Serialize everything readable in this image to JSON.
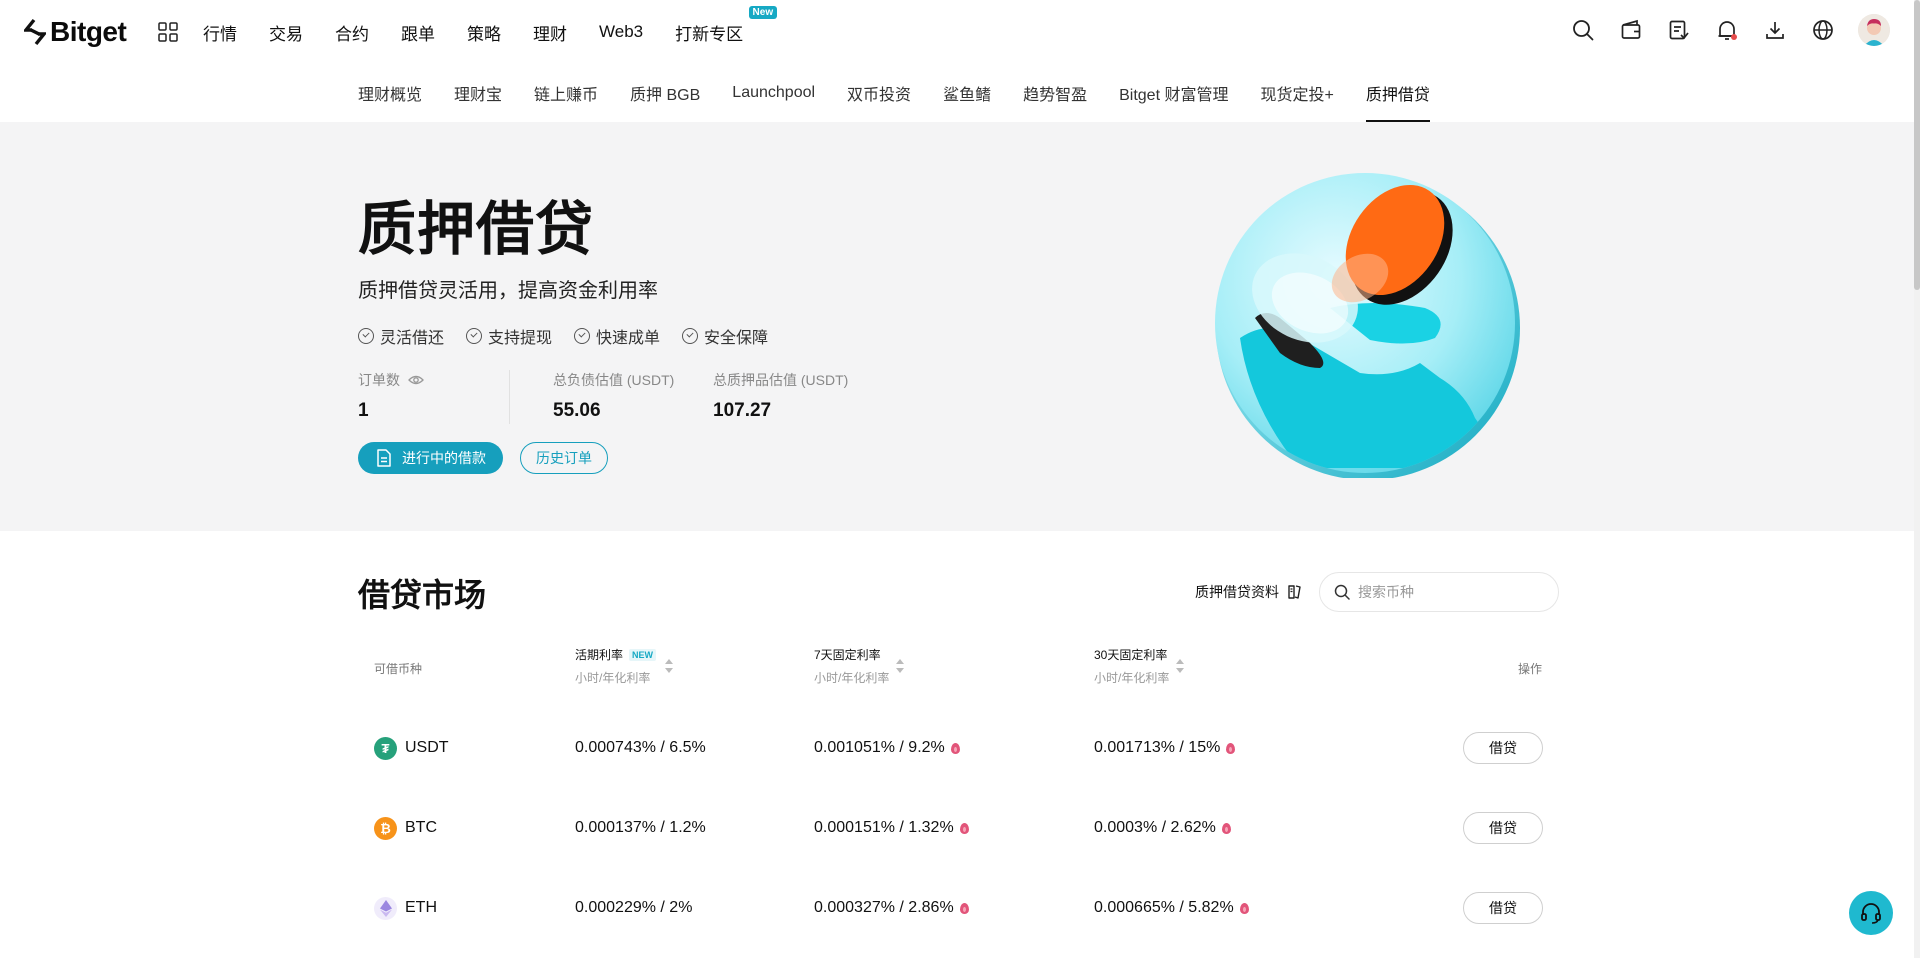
{
  "brand": {
    "name": "Bitget"
  },
  "topmenu": [
    "行情",
    "交易",
    "合约",
    "跟单",
    "策略",
    "理财",
    "Web3",
    "打新专区"
  ],
  "new_badge": "New",
  "subtabs": [
    "理财概览",
    "理财宝",
    "链上赚币",
    "质押 BGB",
    "Launchpool",
    "双币投资",
    "鲨鱼鳍",
    "趋势智盈",
    "Bitget 财富管理",
    "现货定投+",
    "质押借贷"
  ],
  "hero": {
    "title": "质押借贷",
    "subtitle": "质押借贷灵活用，提高资金利用率",
    "features": [
      "灵活借还",
      "支持提现",
      "快速成单",
      "安全保障"
    ],
    "stats": [
      {
        "label": "订单数",
        "value": "1"
      },
      {
        "label": "总负债估值 (USDT)",
        "value": "55.06"
      },
      {
        "label": "总质押品估值 (USDT)",
        "value": "107.27"
      }
    ],
    "btn_active": "进行中的借款",
    "btn_history": "历史订单"
  },
  "market": {
    "title": "借贷市场",
    "doc_link": "质押借贷资料",
    "search_placeholder": "搜索币种",
    "headers": {
      "coin": "可借币种",
      "flex": "活期利率",
      "flex_badge": "NEW",
      "d7": "7天固定利率",
      "d30": "30天固定利率",
      "sub": "小时/年化利率",
      "action": "操作"
    },
    "rows": [
      {
        "coin": "USDT",
        "flex": "0.000743% / 6.5%",
        "d7": "0.001051% / 9.2%",
        "d30": "0.001713% / 15%",
        "action": "借贷"
      },
      {
        "coin": "BTC",
        "flex": "0.000137% / 1.2%",
        "d7": "0.000151% / 1.32%",
        "d30": "0.0003% / 2.62%",
        "action": "借贷"
      },
      {
        "coin": "ETH",
        "flex": "0.000229% / 2%",
        "d7": "0.000327% / 2.86%",
        "d30": "0.000665% / 5.82%",
        "action": "借贷"
      }
    ]
  },
  "colors": {
    "accent": "#169fbd",
    "hero_bg": "#f4f4f5",
    "usdt": "#26a17b",
    "btc": "#f7931a",
    "eth": "#c9b8f0",
    "flame": "#e2557a"
  }
}
